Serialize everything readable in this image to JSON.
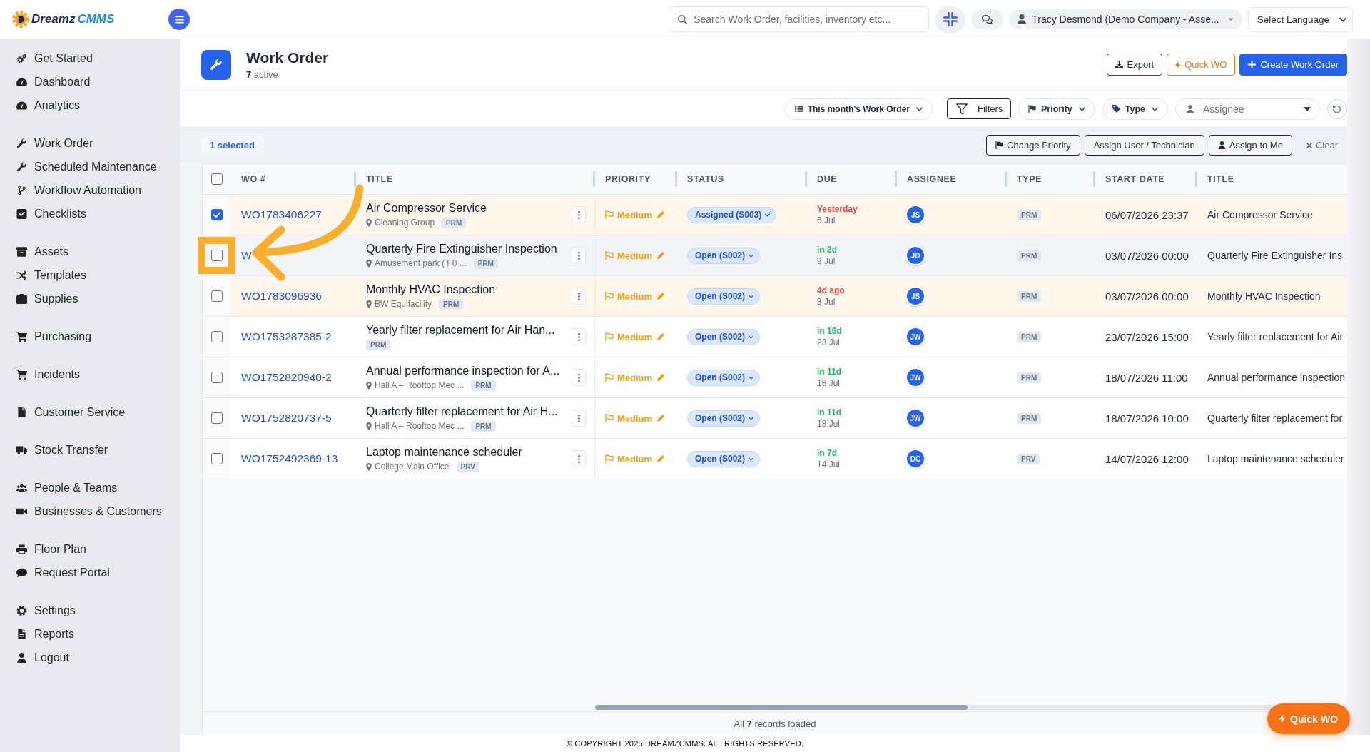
{
  "topbar": {
    "brand": {
      "name": "Dreamz",
      "suffix": "CMMS"
    },
    "search": {
      "placeholder": "Search Work Order, facilities, inventory etc..."
    },
    "user": "Tracy Desmond (Demo Company - Asse...",
    "language": "Select Language"
  },
  "sidebar": {
    "groups": [
      [
        "Get Started",
        "Dashboard",
        "Analytics"
      ],
      [
        "Work Order",
        "Scheduled Maintenance",
        "Workflow Automation",
        "Checklists"
      ],
      [
        "Assets",
        "Templates",
        "Supplies"
      ],
      [
        "Purchasing"
      ],
      [
        "Incidents"
      ],
      [
        "Customer Service"
      ],
      [
        "Stock Transfer"
      ],
      [
        "People & Teams",
        "Businesses & Customers"
      ],
      [
        "Floor Plan",
        "Request Portal"
      ],
      [
        "Settings",
        "Reports",
        "Logout"
      ]
    ]
  },
  "page_header": {
    "title": "Work Order",
    "subtitle": "**7** active",
    "actions": [
      {
        "label": "Export",
        "kind": "outline"
      },
      {
        "label": "Quick WO",
        "kind": "warning"
      },
      {
        "label": "Create Work Order",
        "kind": "primary"
      }
    ]
  },
  "filter_bar": {
    "view": "This month’s Work Order",
    "filters": "Filters",
    "priority": "Priority",
    "type": "Type",
    "assignee": {
      "placeholder": "Assignee"
    }
  },
  "selection_bar": {
    "count": "1 selected",
    "actions": [
      {
        "label": "Change Priority",
        "kind": "priority"
      },
      {
        "label": "Assign User / Technician",
        "kind": "assign"
      },
      {
        "label": "Assign to Me",
        "kind": "self"
      }
    ],
    "clear": "Clear"
  },
  "table": {
    "select_all": {
      "checked": false
    },
    "columns": [
      "WO #",
      "TITLE",
      "PRIORITY",
      "STATUS",
      "DUE",
      "ASSIGNEE",
      "TYPE",
      "START DATE",
      "TITLE"
    ],
    "rows": [
      {
        "selected": true,
        "overdue": true,
        "hovered": false,
        "wo": "WO1783406227",
        "title": "Air Compressor Service",
        "details": [
          {
            "kind": "location",
            "text": "Cleaning Group"
          },
          {
            "kind": "tag",
            "text": "PRM"
          }
        ],
        "priority": "Medium",
        "status": "Assigned (S003)",
        "due": "Yesterday",
        "due_date": "6 Jul",
        "assignee": "JS",
        "type": "PRM",
        "start_date": "06/07/2026 23:37",
        "title_2": "Air Compressor Service"
      },
      {
        "selected": false,
        "overdue": false,
        "hovered": true,
        "wo": "W",
        "title": "Quarterly Fire Extinguisher Inspection",
        "details": [
          {
            "kind": "location",
            "text": "Amusement park ( F0 ..."
          },
          {
            "kind": "tag",
            "text": "PRM"
          }
        ],
        "priority": "Medium",
        "status": "Open (S002)",
        "due": "in 2d",
        "due_date": "9 Jul",
        "assignee": "JD",
        "type": "PRM",
        "start_date": "03/07/2026 00:00",
        "title_2": "Quarterly Fire Extinguisher Ins"
      },
      {
        "selected": false,
        "overdue": true,
        "hovered": false,
        "wo": "WO1783096936",
        "title": "Monthly HVAC Inspection",
        "details": [
          {
            "kind": "location",
            "text": "BW Equifacility"
          },
          {
            "kind": "tag",
            "text": "PRM"
          }
        ],
        "priority": "Medium",
        "status": "Open (S002)",
        "due": "4d ago",
        "due_date": "3 Jul",
        "assignee": "JS",
        "type": "PRM",
        "start_date": "03/07/2026 00:00",
        "title_2": "Monthly HVAC Inspection"
      },
      {
        "selected": false,
        "overdue": false,
        "hovered": false,
        "wo": "WO1753287385-2",
        "title": "Yearly filter replacement for Air Han...",
        "details": [
          {
            "kind": "tag",
            "text": "PRM"
          }
        ],
        "priority": "Medium",
        "status": "Open (S002)",
        "due": "in 16d",
        "due_date": "23 Jul",
        "assignee": "JW",
        "type": "PRM",
        "start_date": "23/07/2026 15:00",
        "title_2": "Yearly filter replacement for Air"
      },
      {
        "selected": false,
        "overdue": false,
        "hovered": false,
        "wo": "WO1752820940-2",
        "title": "Annual performance inspection for A...",
        "details": [
          {
            "kind": "location",
            "text": "Hall A – Rooftop Mec ..."
          },
          {
            "kind": "tag",
            "text": "PRM"
          }
        ],
        "priority": "Medium",
        "status": "Open (S002)",
        "due": "in 11d",
        "due_date": "18 Jul",
        "assignee": "JW",
        "type": "PRM",
        "start_date": "18/07/2026 11:00",
        "title_2": "Annual performance inspection"
      },
      {
        "selected": false,
        "overdue": false,
        "hovered": false,
        "wo": "WO1752820737-5",
        "title": "Quarterly filter replacement for Air H...",
        "details": [
          {
            "kind": "location",
            "text": "Hall A – Rooftop Mec ..."
          },
          {
            "kind": "tag",
            "text": "PRM"
          }
        ],
        "priority": "Medium",
        "status": "Open (S002)",
        "due": "in 11d",
        "due_date": "18 Jul",
        "assignee": "JW",
        "type": "PRM",
        "start_date": "18/07/2026 10:00",
        "title_2": "Quarterly filter replacement for"
      },
      {
        "selected": false,
        "overdue": false,
        "hovered": false,
        "wo": "WO1752492369-13",
        "title": "Laptop maintenance scheduler",
        "details": [
          {
            "kind": "location",
            "text": "College Main Office"
          },
          {
            "kind": "tag",
            "text": "PRV"
          }
        ],
        "priority": "Medium",
        "status": "Open (S002)",
        "due": "in 7d",
        "due_date": "14 Jul",
        "assignee": "DC",
        "type": "PRV",
        "start_date": "14/07/2026 12:00",
        "title_2": "Laptop maintenance scheduler"
      }
    ],
    "footer": "All **7** records loaded"
  },
  "quick_action": "Quick WO",
  "copyright": "© COPYRIGHT 2025 DREAMZCMMS. ALL RIGHTS RESERVED."
}
